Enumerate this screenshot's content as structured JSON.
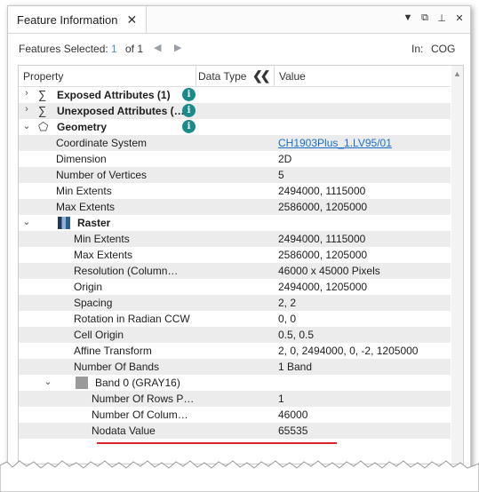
{
  "tab": {
    "title": "Feature Information",
    "close": "✕"
  },
  "window_buttons": {
    "menu": "▼",
    "restore": "⧉",
    "pin": "⊥",
    "close": "✕"
  },
  "toolbar": {
    "features_selected_label": "Features Selected:",
    "features_selected_value": "1",
    "of_text": "of 1",
    "prev": "◀",
    "next": "▶",
    "in_label": "In:",
    "in_value": "COG"
  },
  "table": {
    "headers": {
      "property": "Property",
      "data_type": "Data Type",
      "value": "Value"
    },
    "rows": [
      {
        "indent": 0,
        "chevron": "›",
        "icon": "∑",
        "label": "Exposed Attributes (1)",
        "bold": true,
        "info": "i",
        "value": ""
      },
      {
        "indent": 0,
        "chevron": "›",
        "icon": "∑",
        "label": "Unexposed Attributes (…",
        "bold": true,
        "info": "i",
        "value": ""
      },
      {
        "indent": 0,
        "chevron": "⌄",
        "icon": "⬠",
        "label": "Geometry",
        "bold": true,
        "info": "i",
        "value": ""
      },
      {
        "indent": 2,
        "label": "Coordinate System",
        "value": "CH1903Plus_1.LV95/01",
        "link": true
      },
      {
        "indent": 2,
        "label": "Dimension",
        "value": "2D"
      },
      {
        "indent": 2,
        "label": "Number of Vertices",
        "value": "5"
      },
      {
        "indent": 2,
        "label": "Min Extents",
        "value": "2494000, 1115000"
      },
      {
        "indent": 2,
        "label": "Max Extents",
        "value": "2586000, 1205000"
      },
      {
        "indent": 1,
        "chevron": "⌄",
        "icon": "raster",
        "label": "Raster",
        "bold": true,
        "value": ""
      },
      {
        "indent": 3,
        "label": "Min Extents",
        "value": "2494000, 1115000"
      },
      {
        "indent": 3,
        "label": "Max Extents",
        "value": "2586000, 1205000"
      },
      {
        "indent": 3,
        "label": "Resolution (Column…",
        "value": "46000 x 45000 Pixels"
      },
      {
        "indent": 3,
        "label": "Origin",
        "value": "2494000, 1205000"
      },
      {
        "indent": 3,
        "label": "Spacing",
        "value": "2, 2"
      },
      {
        "indent": 3,
        "label": "Rotation in Radian CCW",
        "value": "0, 0"
      },
      {
        "indent": 3,
        "label": "Cell Origin",
        "value": "0.5, 0.5"
      },
      {
        "indent": 3,
        "label": "Affine Transform",
        "value": "2, 0, 2494000, 0, -2, 1205000"
      },
      {
        "indent": 3,
        "label": "Number Of Bands",
        "value": "1 Band"
      },
      {
        "indent": 2,
        "chevron": "⌄",
        "icon": "band",
        "label": "Band 0 (GRAY16)",
        "bold": false,
        "value": ""
      },
      {
        "indent": 4,
        "label": "Number Of Rows P…",
        "value": "1"
      },
      {
        "indent": 4,
        "label": "Number Of Colum…",
        "value": "46000"
      },
      {
        "indent": 4,
        "label": "Nodata Value",
        "value": "65535"
      }
    ]
  },
  "colors": {
    "accent_link": "#1a6fc8",
    "info_badge": "#1a8a8a",
    "annotation": "#d9262a"
  }
}
